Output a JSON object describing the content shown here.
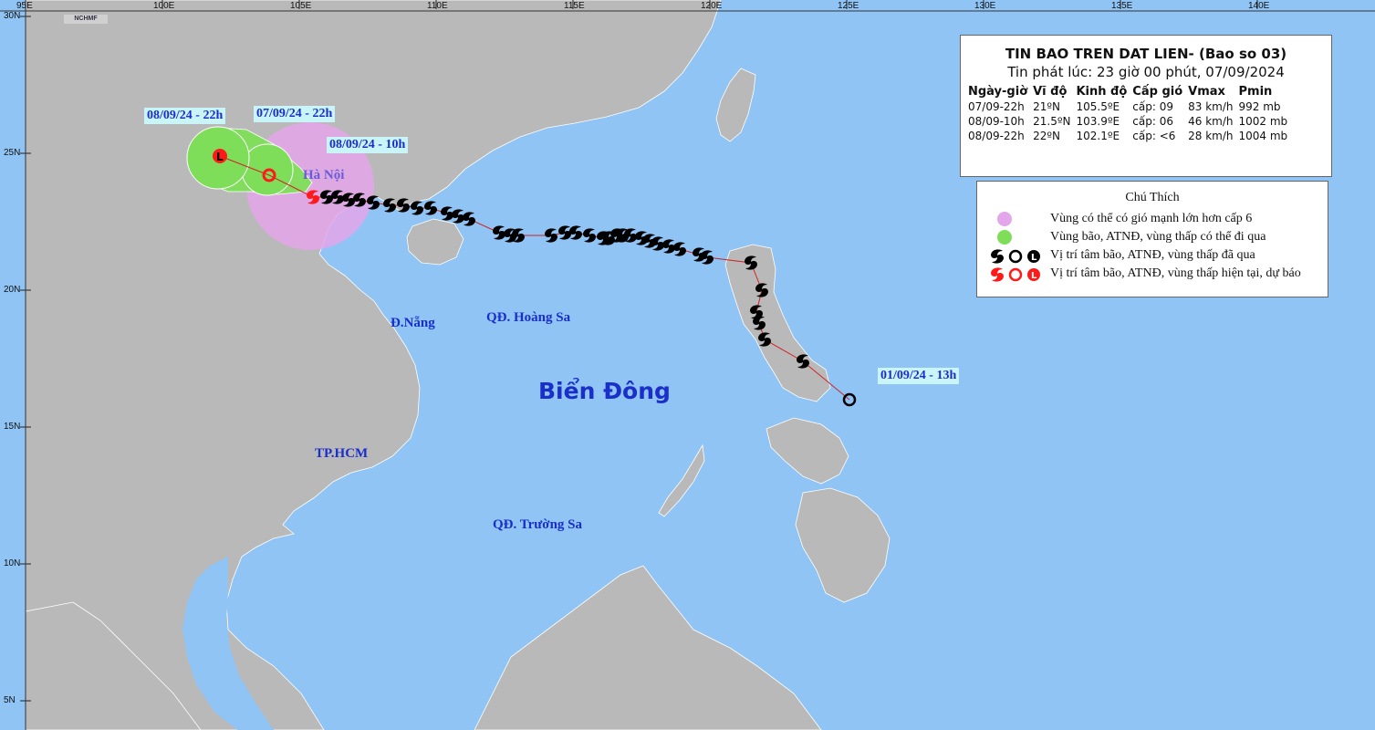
{
  "header": {
    "title": "TIN BAO TREN DAT LIEN- (Bao so 03)",
    "issued": "Tin phát lúc: 23 giờ 00 phút, 07/09/2024"
  },
  "table": {
    "columns": [
      "Ngày-giờ",
      "Vĩ độ",
      "Kinh độ",
      "Cấp gió",
      "Vmax",
      "Pmin"
    ],
    "rows": [
      [
        "07/09-22h",
        "21ºN",
        "105.5ºE",
        "cấp: 09",
        "83 km/h",
        "992 mb"
      ],
      [
        "08/09-10h",
        "21.5ºN",
        "103.9ºE",
        "cấp: 06",
        "46 km/h",
        "1002 mb"
      ],
      [
        "08/09-22h",
        "22ºN",
        "102.1ºE",
        "cấp: <6",
        "28 km/h",
        "1004 mb"
      ]
    ]
  },
  "legend": {
    "title": "Chú Thích",
    "items": [
      {
        "text": "Vùng có thể có gió mạnh lớn hơn cấp 6",
        "color": "#e4a6ea"
      },
      {
        "text": "Vùng bão, ATNĐ, vùng thấp có thể đi qua",
        "color": "#7ede5a"
      },
      {
        "text": "Vị trí tâm bão, ATNĐ, vùng thấp đã qua",
        "color": "#000000"
      },
      {
        "text": "Vị trí tâm bão, ATNĐ, vùng thấp hiện tại, dự báo",
        "color": "#ff1a1a"
      }
    ]
  },
  "map_labels": {
    "date_start": "01/09/24 - 13h",
    "date_current": "07/09/24 - 22h",
    "date_f1": "08/09/24 - 10h",
    "date_f2": "08/09/24 - 22h",
    "hanoi": "Hà Nội",
    "danang": "Đ.Nẵng",
    "hoangsa": "QĐ. Hoàng Sa",
    "hcm": "TP.HCM",
    "truongsa": "QĐ. Trường Sa",
    "sea": "Biển Đông",
    "logo": "NCHMF"
  },
  "axes": {
    "lon_ticks": [
      "95E",
      "100E",
      "105E",
      "110E",
      "115E",
      "120E",
      "125E",
      "130E",
      "135E",
      "140E"
    ],
    "lat_ticks": [
      "30N",
      "25N",
      "20N",
      "15N",
      "10N",
      "5N"
    ]
  },
  "colors": {
    "sea": "#8fc4f4",
    "land": "#b9b9b9",
    "wind_zone": "#e4a6ea",
    "cone": "#7ede5a",
    "past_symbol": "#000000",
    "forecast_symbol": "#ff1a1a",
    "track_line": "#d22222",
    "label_text": "#1a2ec9"
  },
  "storm": {
    "name": "Bao so 03",
    "past_track": [
      [
        16,
        125.1
      ],
      [
        17.4,
        123.4
      ],
      [
        18.2,
        122.0
      ],
      [
        18.8,
        121.8
      ],
      [
        19.2,
        121.7
      ],
      [
        20.0,
        121.9
      ],
      [
        21.0,
        121.5
      ],
      [
        21.2,
        119.9
      ],
      [
        21.3,
        119.6
      ],
      [
        21.5,
        118.9
      ],
      [
        21.6,
        118.5
      ],
      [
        21.7,
        118.1
      ],
      [
        21.8,
        117.8
      ],
      [
        21.9,
        117.5
      ],
      [
        22.0,
        117.1
      ],
      [
        22.0,
        116.8
      ],
      [
        22.0,
        116.6
      ],
      [
        21.9,
        116.3
      ],
      [
        21.9,
        116.1
      ],
      [
        22.0,
        115.6
      ],
      [
        22.1,
        115.1
      ],
      [
        22.1,
        114.7
      ],
      [
        22.0,
        114.2
      ],
      [
        22.0,
        113.0
      ],
      [
        22.0,
        112.7
      ],
      [
        22.1,
        112.3
      ],
      [
        22.6,
        111.2
      ],
      [
        22.7,
        110.8
      ],
      [
        22.8,
        110.4
      ],
      [
        23.0,
        109.8
      ],
      [
        23.0,
        109.3
      ],
      [
        23.1,
        108.8
      ],
      [
        23.1,
        108.3
      ],
      [
        23.2,
        107.7
      ],
      [
        23.3,
        107.2
      ],
      [
        23.3,
        106.8
      ],
      [
        23.4,
        106.4
      ],
      [
        23.4,
        106.0
      ]
    ],
    "current": [
      23.4,
      105.5
    ],
    "forecast": [
      [
        24.2,
        103.9
      ],
      [
        24.9,
        102.1
      ]
    ]
  }
}
